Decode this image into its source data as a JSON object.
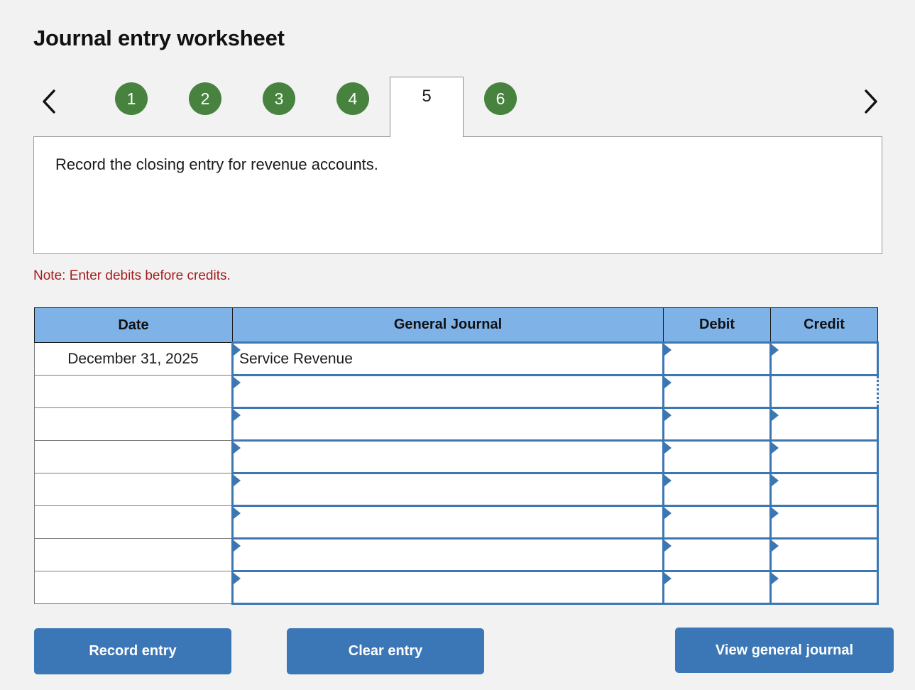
{
  "worksheet": {
    "title": "Journal entry worksheet",
    "prompt": "Record the closing entry for revenue accounts.",
    "note": "Note: Enter debits before credits."
  },
  "nav": {
    "prev_icon": "chevron-left-icon",
    "next_icon": "chevron-right-icon",
    "active_tab": "5",
    "tabs": [
      {
        "label": "1",
        "active": false
      },
      {
        "label": "2",
        "active": false
      },
      {
        "label": "3",
        "active": false
      },
      {
        "label": "4",
        "active": false
      },
      {
        "label": "5",
        "active": true
      },
      {
        "label": "6",
        "active": false
      }
    ]
  },
  "journal": {
    "headers": {
      "date": "Date",
      "general_journal": "General Journal",
      "debit": "Debit",
      "credit": "Credit"
    },
    "rows": [
      {
        "date": "December 31, 2025",
        "account": "Service Revenue",
        "debit": "",
        "credit": "",
        "credit_focused": false
      },
      {
        "date": "",
        "account": "",
        "debit": "",
        "credit": "",
        "credit_focused": true
      },
      {
        "date": "",
        "account": "",
        "debit": "",
        "credit": "",
        "credit_focused": false
      },
      {
        "date": "",
        "account": "",
        "debit": "",
        "credit": "",
        "credit_focused": false
      },
      {
        "date": "",
        "account": "",
        "debit": "",
        "credit": "",
        "credit_focused": false
      },
      {
        "date": "",
        "account": "",
        "debit": "",
        "credit": "",
        "credit_focused": false
      },
      {
        "date": "",
        "account": "",
        "debit": "",
        "credit": "",
        "credit_focused": false
      },
      {
        "date": "",
        "account": "",
        "debit": "",
        "credit": "",
        "credit_focused": false
      }
    ]
  },
  "actions": {
    "record": "Record entry",
    "clear": "Clear entry",
    "view": "View general journal"
  },
  "colors": {
    "tab_green": "#47823f",
    "header_blue": "#7fb3e8",
    "input_border_blue": "#3c77b4",
    "button_blue": "#3b77b6",
    "note_red": "#a41d1d",
    "page_bg": "#f2f2f2"
  }
}
